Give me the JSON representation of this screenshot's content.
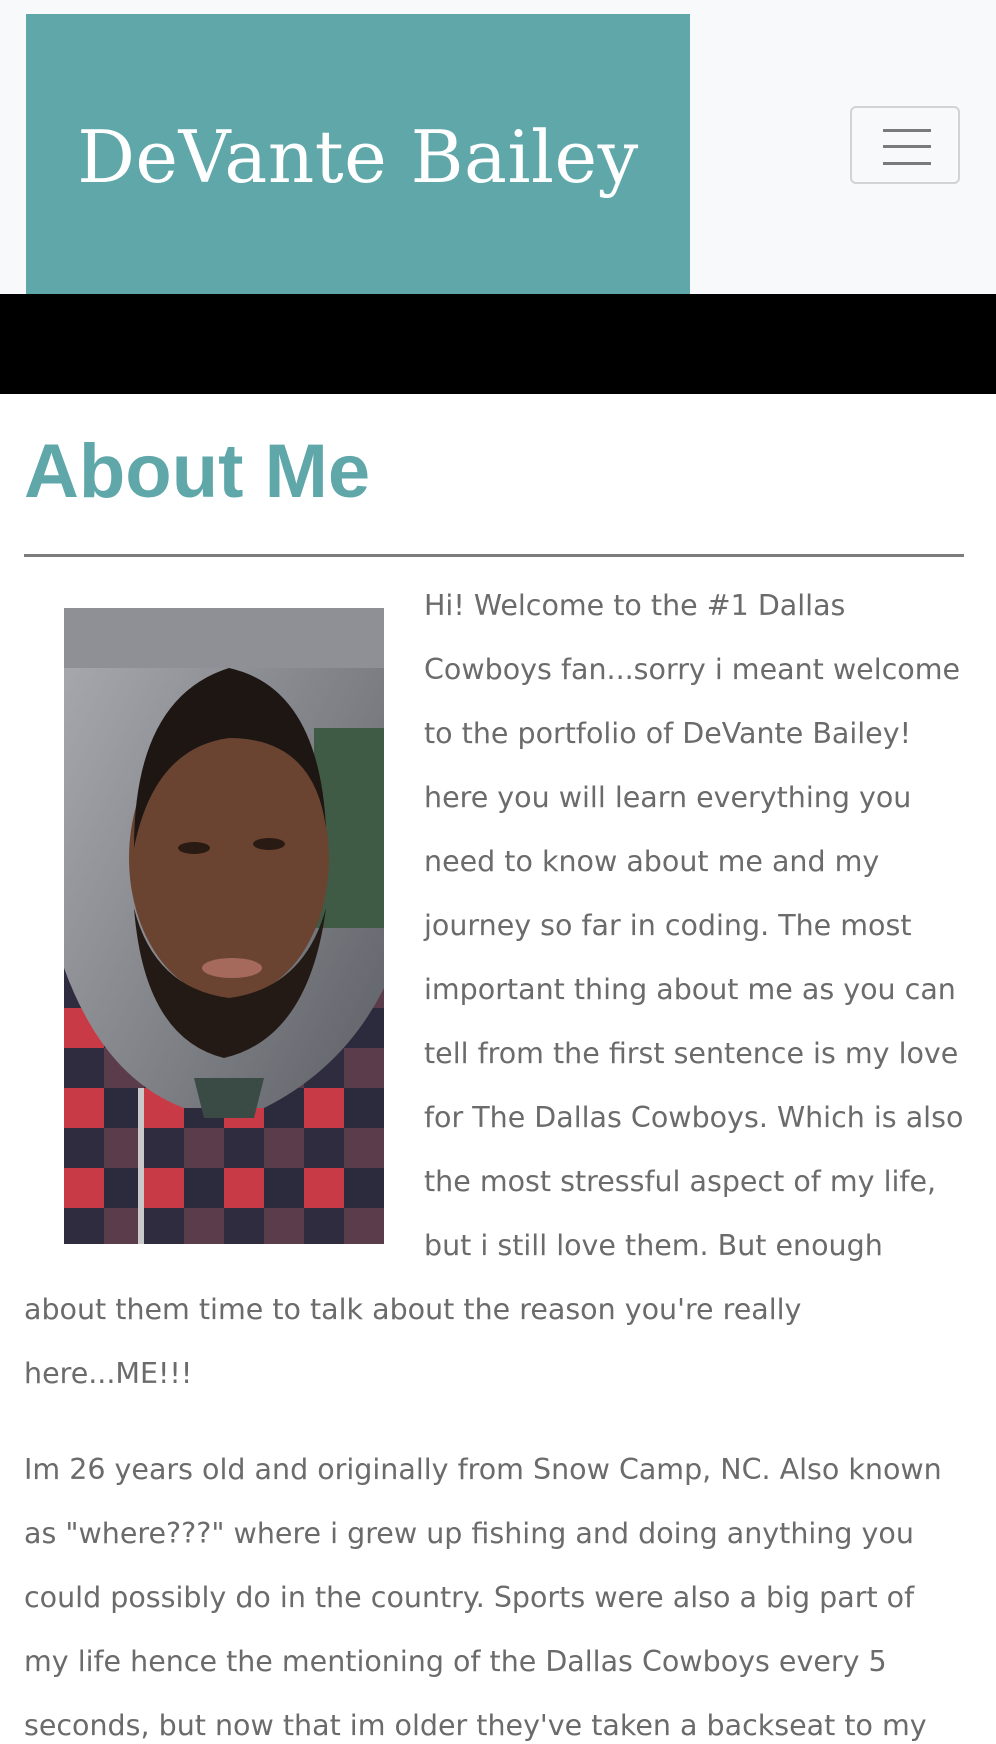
{
  "navbar": {
    "brand": "DeVante Bailey",
    "toggler_icon": "hamburger-menu-icon"
  },
  "about": {
    "heading": "About Me",
    "photo_subject": "portrait of DeVante Bailey",
    "paragraph1": "Hi! Welcome to the #1 Dallas Cowboys fan...sorry i meant welcome to the portfolio of DeVante Bailey! here you will learn everything you need to know about me and my journey so far in coding. The most important thing about me as you can tell from the first sentence is my love for The Dallas Cowboys. Which is also the most stressful aspect of my life, but i still love them. But enough about them time to talk about the reason you're really here...ME!!!",
    "paragraph2": "Im 26 years old and originally from Snow Camp, NC. Also known as \"where???\" where i grew up fishing and doing anything you could possibly do in the country. Sports were also a big part of my life hence the mentioning of the Dallas Cowboys every 5 seconds, but now that im older they've taken a backseat to my"
  },
  "colors": {
    "accent": "#5fa7a9",
    "navbar_bg": "#f8f9fa",
    "text": "#6b6b6b",
    "stripe": "#1f1e1e"
  }
}
